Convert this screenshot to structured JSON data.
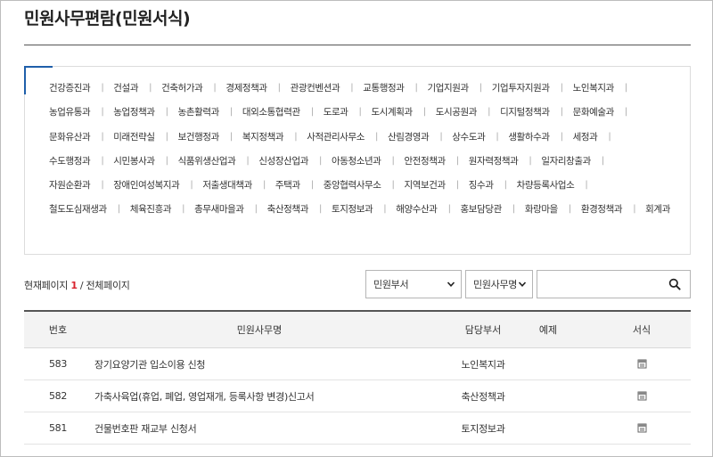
{
  "page": {
    "title": "민원사무편람(민원서식)"
  },
  "departments": [
    "건강증진과",
    "건설과",
    "건축허가과",
    "경제정책과",
    "관광컨벤션과",
    "교통행정과",
    "기업지원과",
    "기업투자지원과",
    "노인복지과",
    "농업유통과",
    "농업정책과",
    "농촌활력과",
    "대외소통협력관",
    "도로과",
    "도시계획과",
    "도시공원과",
    "디지털정책과",
    "문화예술과",
    "문화유산과",
    "미래전략실",
    "보건행정과",
    "복지정책과",
    "사적관리사무소",
    "산림경영과",
    "상수도과",
    "생활하수과",
    "세정과",
    "수도행정과",
    "시민봉사과",
    "식품위생산업과",
    "신성장산업과",
    "아동청소년과",
    "안전정책과",
    "원자력정책과",
    "일자리창출과",
    "자원순환과",
    "장애인여성복지과",
    "저출생대책과",
    "주택과",
    "중앙협력사무소",
    "지역보건과",
    "징수과",
    "차량등록사업소",
    "철도도심재생과",
    "체육진흥과",
    "총무새마을과",
    "축산정책과",
    "토지정보과",
    "해양수산과",
    "홍보담당관",
    "화랑마을",
    "환경정책과",
    "회계과"
  ],
  "paging": {
    "label_prefix": "현재페이지",
    "current": "1",
    "separator": "/",
    "label_suffix": "전체페이지"
  },
  "filters": {
    "dept_select": "민원부서",
    "name_select": "민원사무명",
    "search_value": ""
  },
  "table": {
    "headers": {
      "no": "번호",
      "name": "민원사무명",
      "dept": "담당부서",
      "example": "예제",
      "form": "서식"
    },
    "rows": [
      {
        "no": "583",
        "name": "장기요양기관 입소이용 신청",
        "dept": "노인복지과",
        "example": ""
      },
      {
        "no": "582",
        "name": "가축사육업(휴업, 폐업, 영업재개, 등록사항 변경)신고서",
        "dept": "축산정책과",
        "example": ""
      },
      {
        "no": "581",
        "name": "건물번호판 재교부 신청서",
        "dept": "토지정보과",
        "example": ""
      }
    ]
  },
  "icons": {
    "search": "search-icon",
    "caret": "chevron-down-icon",
    "form": "form-file-icon"
  },
  "colors": {
    "accent": "#1f5faa",
    "current_page": "#d9232e"
  }
}
